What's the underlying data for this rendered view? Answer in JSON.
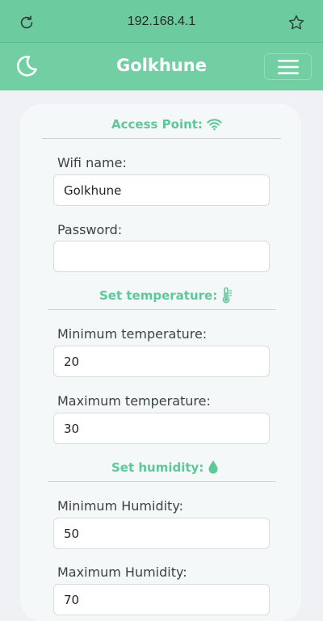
{
  "browser": {
    "url": "192.168.4.1"
  },
  "header": {
    "title": "Golkhune"
  },
  "sections": {
    "access_point": {
      "title": "Access Point:",
      "wifi_label": "Wifi name:",
      "wifi_value": "Golkhune",
      "password_label": "Password:",
      "password_value": ""
    },
    "temperature": {
      "title": "Set temperature:",
      "min_label": "Minimum temperature:",
      "min_value": "20",
      "max_label": "Maximum temperature:",
      "max_value": "30"
    },
    "humidity": {
      "title": "Set humidity:",
      "min_label": "Minimum Humidity:",
      "min_value": "50",
      "max_label": "Maximum Humidity:",
      "max_value": "70"
    }
  },
  "icons": {
    "reload": "reload-icon",
    "star": "star-icon",
    "moon": "moon-icon",
    "menu": "hamburger-menu-icon",
    "wifi": "wifi-icon",
    "thermometer": "thermometer-icon",
    "droplet": "droplet-icon"
  },
  "colors": {
    "accent": "#71cfa3",
    "accent_text": "#5fc79a",
    "background": "#f0f1f5",
    "card": "#f5f8f9"
  }
}
